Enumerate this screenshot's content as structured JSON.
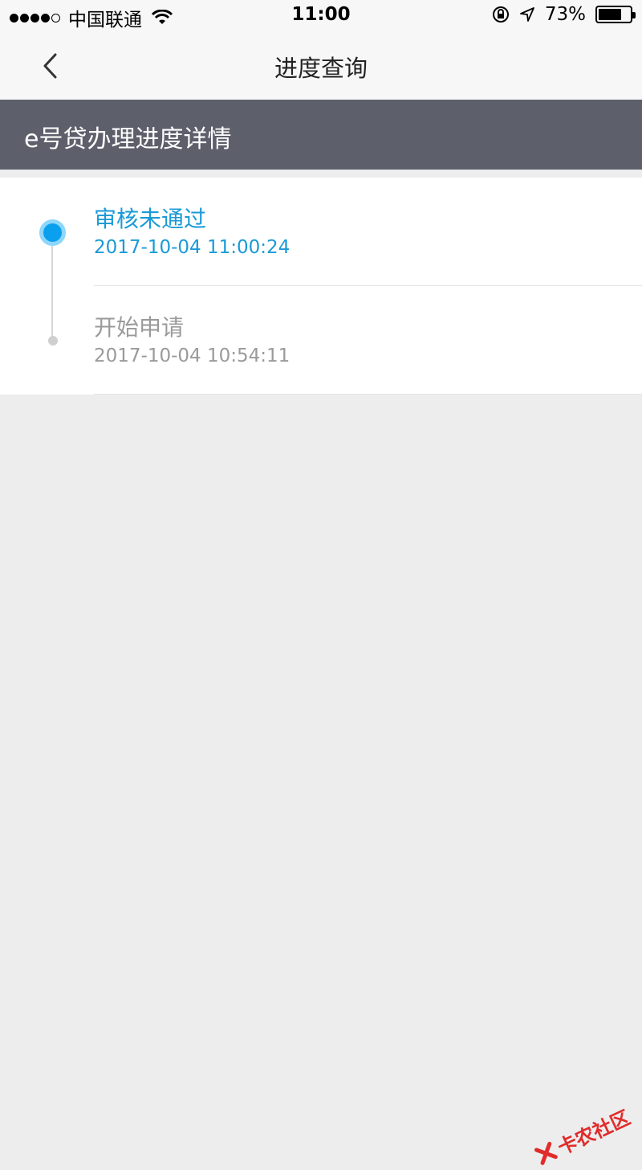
{
  "status_bar": {
    "carrier": "中国联通",
    "time": "11:00",
    "battery_percent": "73%",
    "battery_level": 0.73
  },
  "nav": {
    "title": "进度查询",
    "back_icon": "chevron-left-icon"
  },
  "section": {
    "title": "e号贷办理进度详情"
  },
  "steps": [
    {
      "status": "审核未通过",
      "time": "2017-10-04 11:00:24",
      "active": true
    },
    {
      "status": "开始申请",
      "time": "2017-10-04 10:54:11",
      "active": false
    }
  ],
  "watermark": {
    "text": "卡农社区"
  },
  "colors": {
    "accent": "#1a9ad6",
    "header_bg": "#5d5f6b",
    "page_bg": "#ededed",
    "inactive_text": "#9a9a9a"
  }
}
